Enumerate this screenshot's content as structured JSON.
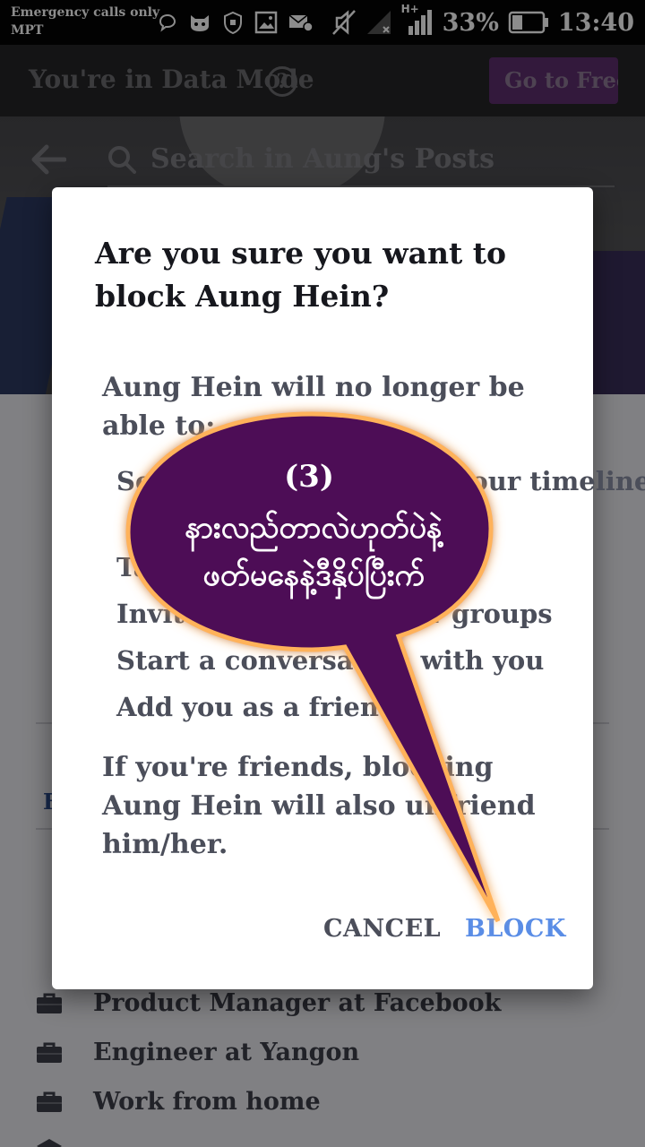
{
  "status_bar": {
    "carrier_line1": "Emergency calls only",
    "carrier_line2": "MPT",
    "network": "H+",
    "battery": "33%",
    "time": "13:40"
  },
  "data_mode": {
    "title": "You're in Data Mode",
    "help_icon": "question-circle-icon",
    "free_button": "Go to Free"
  },
  "header": {
    "back_icon": "back-arrow-icon",
    "search_placeholder": "Search in Aung's Posts"
  },
  "profile": {
    "work": [
      {
        "icon": "briefcase-icon",
        "text": "Product Manager at Facebook"
      },
      {
        "icon": "briefcase-icon",
        "text": "Engineer at Yangon"
      },
      {
        "icon": "briefcase-icon",
        "text": "Work from home"
      }
    ]
  },
  "dialog": {
    "title": "Are you sure you want to block Aung Hein?",
    "intro": "Aung Hein will no longer be able to:",
    "items": [
      "See things you post on your timeline",
      "Tag you",
      "Invite you to events or groups",
      "Start a conversation with you",
      "Add you as a friend"
    ],
    "footer": "If you're friends, blocking Aung Hein will also unfriend him/her.",
    "cancel": "CANCEL",
    "block": "BLOCK"
  },
  "annotation": {
    "number": "(3)",
    "line1": "နားလည်တာလဲဟုတ်ပဲနဲ့",
    "line2": "ဖတ်မနေနဲ့ဒီနှိပ်ပြီးက်",
    "fill": "#4d0b57",
    "glow": "#ff9a2e"
  }
}
